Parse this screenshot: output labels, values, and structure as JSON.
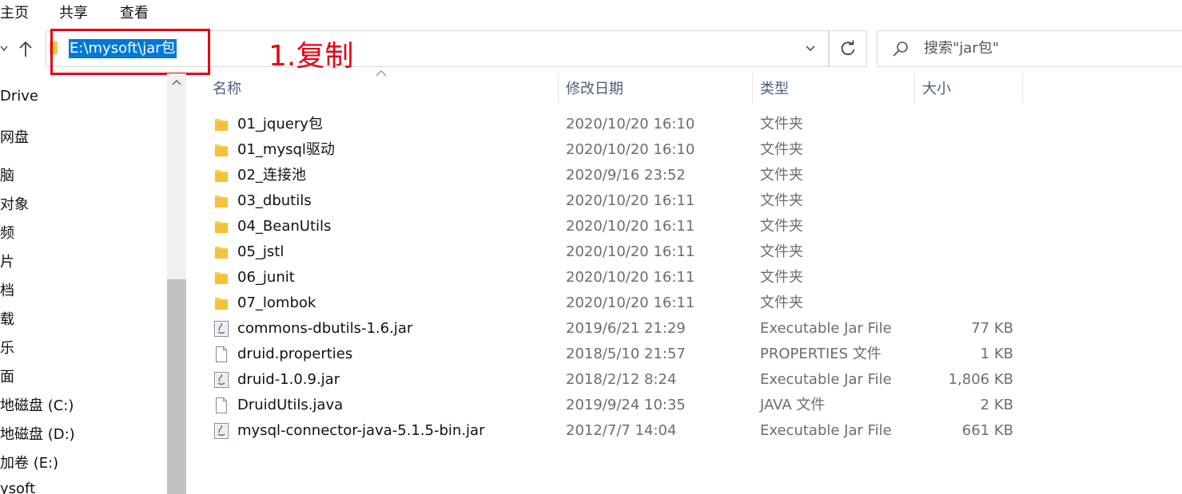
{
  "ribbon": {
    "tabs": [
      "主页",
      "共享",
      "查看"
    ]
  },
  "address": {
    "path": "E:\\mysoft\\jar包"
  },
  "annotation": {
    "text": "1.复制",
    "color": "#e60012"
  },
  "search": {
    "placeholder": "搜索\"jar包\""
  },
  "sidebar": {
    "items": [
      "Drive",
      "网盘",
      "脑",
      "对象",
      "频",
      "片",
      "档",
      "载",
      "乐",
      "面",
      "地磁盘 (C:)",
      "地磁盘 (D:)",
      "加卷 (E:)",
      "ysoft"
    ]
  },
  "columns": {
    "name": "名称",
    "date": "修改日期",
    "type": "类型",
    "size": "大小"
  },
  "files": [
    {
      "name": "01_jquery包",
      "date": "2020/10/20 16:10",
      "type": "文件夹",
      "size": "",
      "icon": "folder-icon"
    },
    {
      "name": "01_mysql驱动",
      "date": "2020/10/20 16:10",
      "type": "文件夹",
      "size": "",
      "icon": "folder-icon"
    },
    {
      "name": "02_连接池",
      "date": "2020/9/16 23:52",
      "type": "文件夹",
      "size": "",
      "icon": "folder-icon"
    },
    {
      "name": "03_dbutils",
      "date": "2020/10/20 16:11",
      "type": "文件夹",
      "size": "",
      "icon": "folder-icon"
    },
    {
      "name": "04_BeanUtils",
      "date": "2020/10/20 16:11",
      "type": "文件夹",
      "size": "",
      "icon": "folder-icon"
    },
    {
      "name": "05_jstl",
      "date": "2020/10/20 16:11",
      "type": "文件夹",
      "size": "",
      "icon": "folder-icon"
    },
    {
      "name": "06_junit",
      "date": "2020/10/20 16:11",
      "type": "文件夹",
      "size": "",
      "icon": "folder-icon"
    },
    {
      "name": "07_lombok",
      "date": "2020/10/20 16:11",
      "type": "文件夹",
      "size": "",
      "icon": "folder-icon"
    },
    {
      "name": "commons-dbutils-1.6.jar",
      "date": "2019/6/21 21:29",
      "type": "Executable Jar File",
      "size": "77 KB",
      "icon": "jar-file-icon"
    },
    {
      "name": "druid.properties",
      "date": "2018/5/10 21:57",
      "type": "PROPERTIES 文件",
      "size": "1 KB",
      "icon": "document-icon"
    },
    {
      "name": "druid-1.0.9.jar",
      "date": "2018/2/12 8:24",
      "type": "Executable Jar File",
      "size": "1,806 KB",
      "icon": "jar-file-icon"
    },
    {
      "name": "DruidUtils.java",
      "date": "2019/9/24 10:35",
      "type": "JAVA 文件",
      "size": "2 KB",
      "icon": "document-icon"
    },
    {
      "name": "mysql-connector-java-5.1.5-bin.jar",
      "date": "2012/7/7 14:04",
      "type": "Executable Jar File",
      "size": "661 KB",
      "icon": "jar-file-icon"
    }
  ]
}
